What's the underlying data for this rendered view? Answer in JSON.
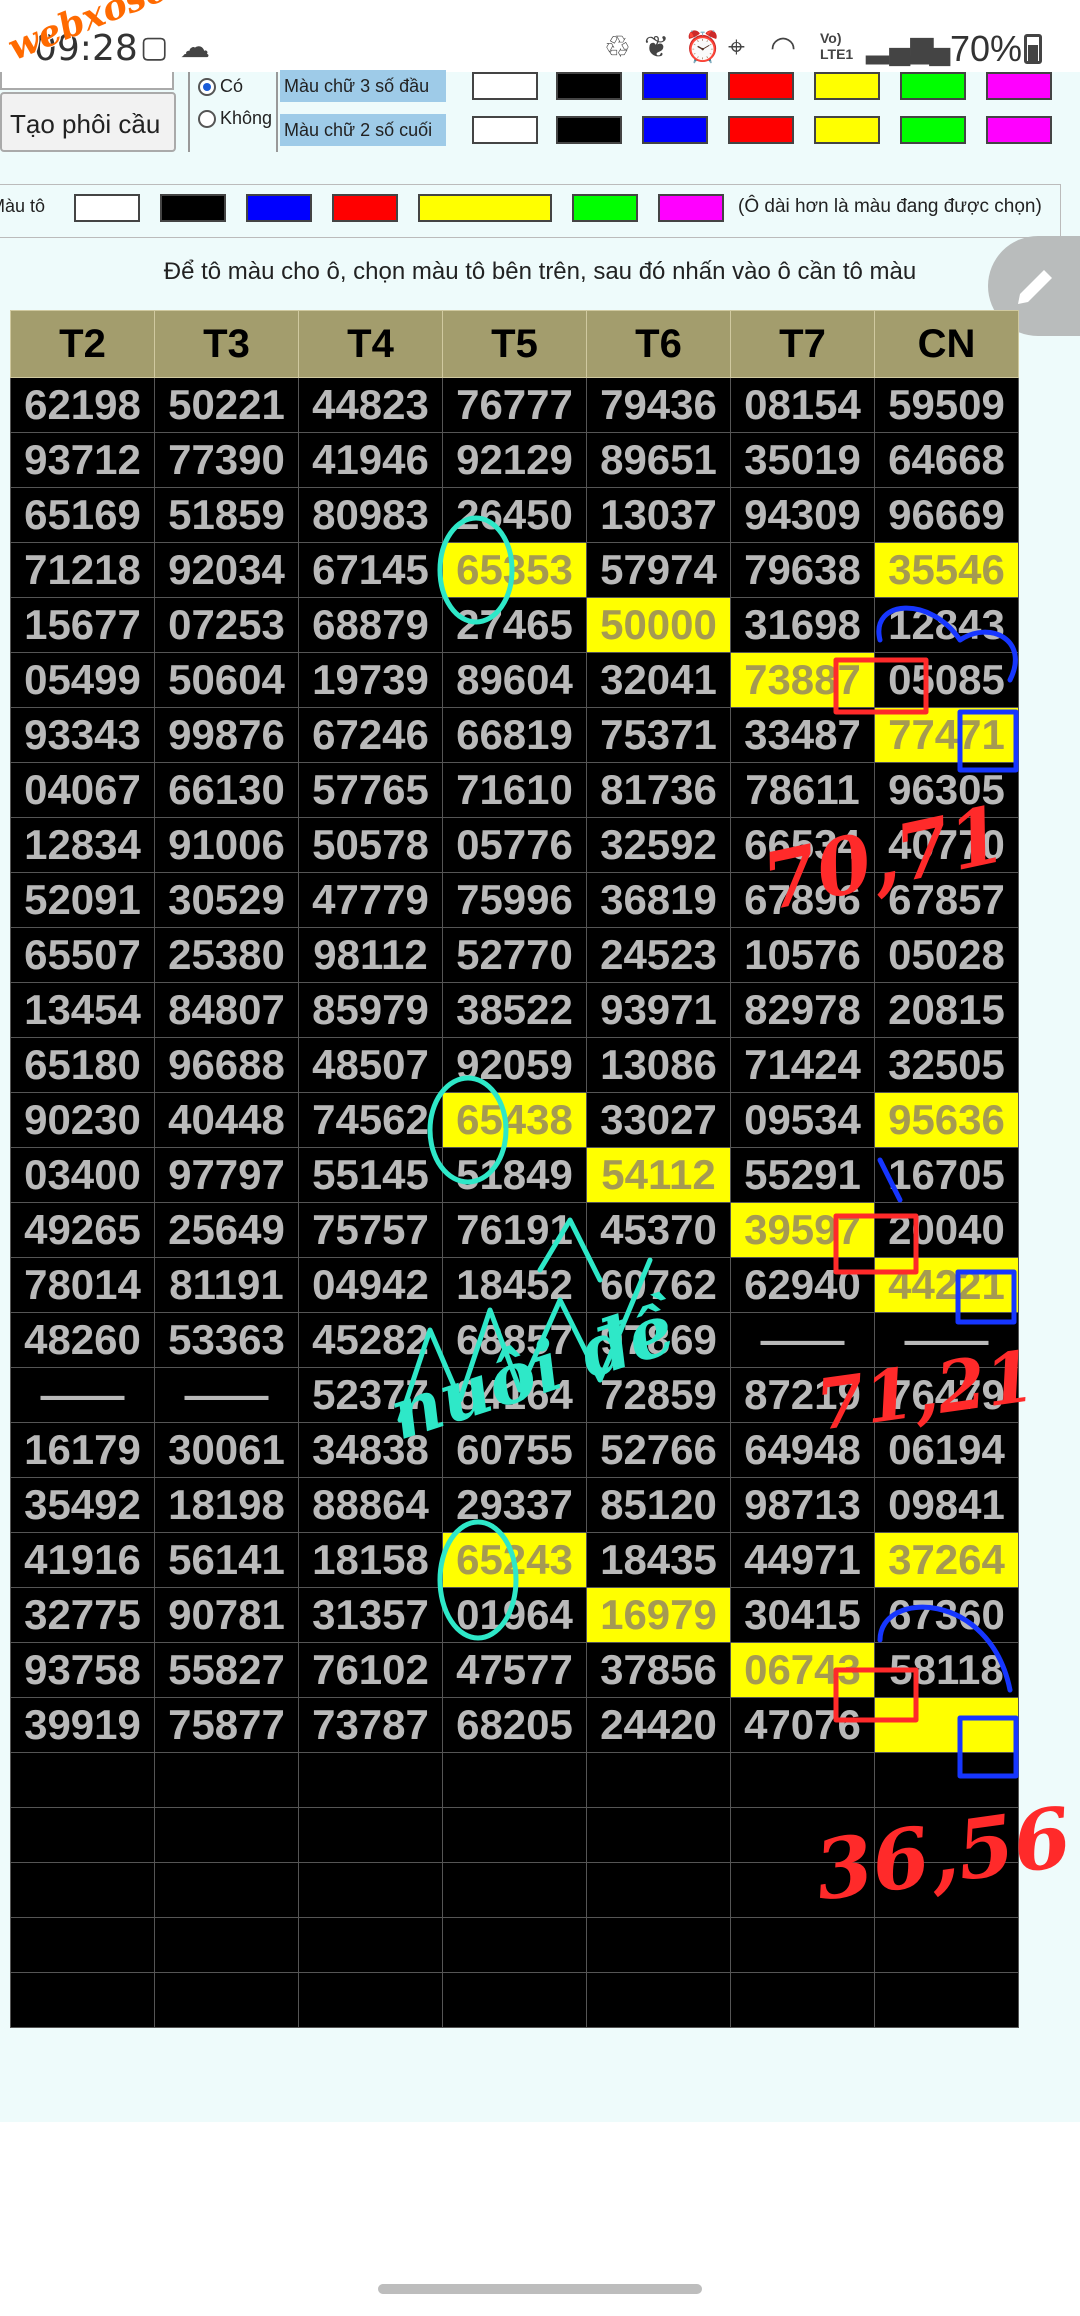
{
  "status_bar": {
    "time": "09:28",
    "battery": "70%",
    "network_label": "Vo) LTE1",
    "watermark": "webxoso.net"
  },
  "controls": {
    "generate_button": "Tạo phôi cầu",
    "option_yes": "Có",
    "option_no": "Không",
    "row_first3_label": "Màu chữ 3 số đầu",
    "row_last2_label": "Màu chữ 2 số cuối",
    "paint_label": "Màu tô",
    "paint_note": "(Ô dài hơn là màu đang được chọn)",
    "instruction": "Để tô màu cho ô, chọn màu tô bên trên, sau đó nhấn vào ô cần tô màu"
  },
  "colors": {
    "swatches": [
      "#ffffff",
      "#000000",
      "#0000ff",
      "#ff0000",
      "#ffff00",
      "#00ff00",
      "#ff00ff"
    ],
    "header_bg": "#a39d6d",
    "highlight": "#ffff00"
  },
  "grid": {
    "headers": [
      "T2",
      "T3",
      "T4",
      "T5",
      "T6",
      "T7",
      "CN"
    ],
    "rows": [
      [
        "62198",
        "50221",
        "44823",
        "76777",
        "79436",
        "08154",
        "59509"
      ],
      [
        "93712",
        "77390",
        "41946",
        "92129",
        "89651",
        "35019",
        "64668"
      ],
      [
        "65169",
        "51859",
        "80983",
        "26450",
        "13037",
        "94309",
        "96669"
      ],
      [
        "71218",
        "92034",
        "67145",
        "65353",
        "57974",
        "79638",
        "35546"
      ],
      [
        "15677",
        "07253",
        "68879",
        "27465",
        "50000",
        "31698",
        "12843"
      ],
      [
        "05499",
        "50604",
        "19739",
        "89604",
        "32041",
        "73887",
        "05085"
      ],
      [
        "93343",
        "99876",
        "67246",
        "66819",
        "75371",
        "33487",
        "77471"
      ],
      [
        "04067",
        "66130",
        "57765",
        "71610",
        "81736",
        "78611",
        "96305"
      ],
      [
        "12834",
        "91006",
        "50578",
        "05776",
        "32592",
        "66534",
        "40770"
      ],
      [
        "52091",
        "30529",
        "47779",
        "75996",
        "36819",
        "67896",
        "67857"
      ],
      [
        "65507",
        "25380",
        "98112",
        "52770",
        "24523",
        "10576",
        "05028"
      ],
      [
        "13454",
        "84807",
        "85979",
        "38522",
        "93971",
        "82978",
        "20815"
      ],
      [
        "65180",
        "96688",
        "48507",
        "92059",
        "13086",
        "71424",
        "32505"
      ],
      [
        "90230",
        "40448",
        "74562",
        "65438",
        "33027",
        "09534",
        "95636"
      ],
      [
        "03400",
        "97797",
        "55145",
        "51849",
        "54112",
        "55291",
        "16705"
      ],
      [
        "49265",
        "25649",
        "75757",
        "76191",
        "45370",
        "39597",
        "20040"
      ],
      [
        "78014",
        "81191",
        "04942",
        "18452",
        "60762",
        "62940",
        "44221"
      ],
      [
        "48260",
        "53363",
        "45282",
        "68857",
        "97869",
        "—",
        "—"
      ],
      [
        "—",
        "—",
        "52377",
        "84164",
        "72859",
        "87219",
        "76479"
      ],
      [
        "16179",
        "30061",
        "34838",
        "60755",
        "52766",
        "64948",
        "06194"
      ],
      [
        "35492",
        "18198",
        "88864",
        "29337",
        "85120",
        "98713",
        "09841"
      ],
      [
        "41916",
        "56141",
        "18158",
        "65243",
        "18435",
        "44971",
        "37264"
      ],
      [
        "32775",
        "90781",
        "31357",
        "01964",
        "16979",
        "30415",
        "67360"
      ],
      [
        "93758",
        "55827",
        "76102",
        "47577",
        "37856",
        "06743",
        "58118"
      ],
      [
        "39919",
        "75877",
        "73787",
        "68205",
        "24420",
        "47076",
        ""
      ],
      [
        "",
        "",
        "",
        "",
        "",
        "",
        ""
      ],
      [
        "",
        "",
        "",
        "",
        "",
        "",
        ""
      ],
      [
        "",
        "",
        "",
        "",
        "",
        "",
        ""
      ],
      [
        "",
        "",
        "",
        "",
        "",
        "",
        ""
      ],
      [
        "",
        "",
        "",
        "",
        "",
        "",
        ""
      ]
    ],
    "highlighted_cells": [
      [
        3,
        3
      ],
      [
        3,
        6
      ],
      [
        4,
        4
      ],
      [
        5,
        5
      ],
      [
        6,
        6
      ],
      [
        13,
        3
      ],
      [
        13,
        6
      ],
      [
        14,
        4
      ],
      [
        15,
        5
      ],
      [
        16,
        6
      ],
      [
        21,
        3
      ],
      [
        21,
        6
      ],
      [
        22,
        4
      ],
      [
        23,
        5
      ],
      [
        24,
        6
      ]
    ]
  },
  "annotations": {
    "red_note_1": "70,71",
    "red_note_2": "71,21",
    "red_note_3": "36,56",
    "cyan_note": "nuôi đề"
  }
}
